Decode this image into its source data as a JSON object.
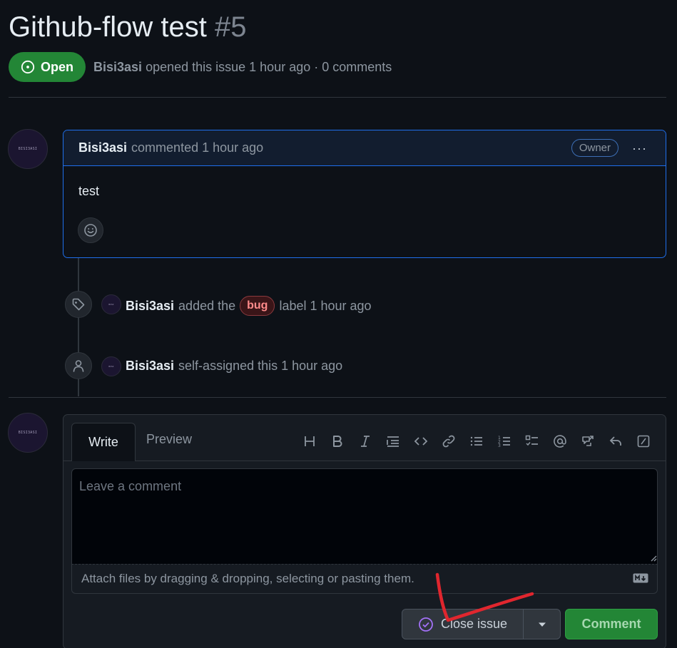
{
  "issue": {
    "title": "Github-flow test",
    "number": "#5",
    "state": "Open",
    "author": "Bisi3asi",
    "meta_text": "opened this issue 1 hour ago · 0 comments"
  },
  "comment": {
    "author": "Bisi3asi",
    "action": "commented 1 hour ago",
    "badge": "Owner",
    "more": "···",
    "body": "test"
  },
  "timeline": [
    {
      "icon": "tag-icon",
      "actor": "Bisi3asi",
      "pre": "added the",
      "label": "bug",
      "post": "label 1 hour ago"
    },
    {
      "icon": "person-icon",
      "actor": "Bisi3asi",
      "text": "self-assigned this 1 hour ago"
    }
  ],
  "editor": {
    "tab_write": "Write",
    "tab_preview": "Preview",
    "toolbar": [
      "heading-icon",
      "bold-icon",
      "italic-icon",
      "quote-icon",
      "code-icon",
      "link-icon",
      "unordered-list-icon",
      "ordered-list-icon",
      "task-list-icon",
      "mention-icon",
      "cross-reference-icon",
      "reply-icon",
      "slash-command-icon"
    ],
    "placeholder": "Leave a comment",
    "attach_hint": "Attach files by dragging & dropping, selecting or pasting them.",
    "close_label": "Close issue",
    "comment_label": "Comment"
  },
  "colors": {
    "open_badge": "#238636",
    "bug_label": "#ff8b8b",
    "comment_border": "#1f6feb",
    "annotation": "#e0262e"
  }
}
